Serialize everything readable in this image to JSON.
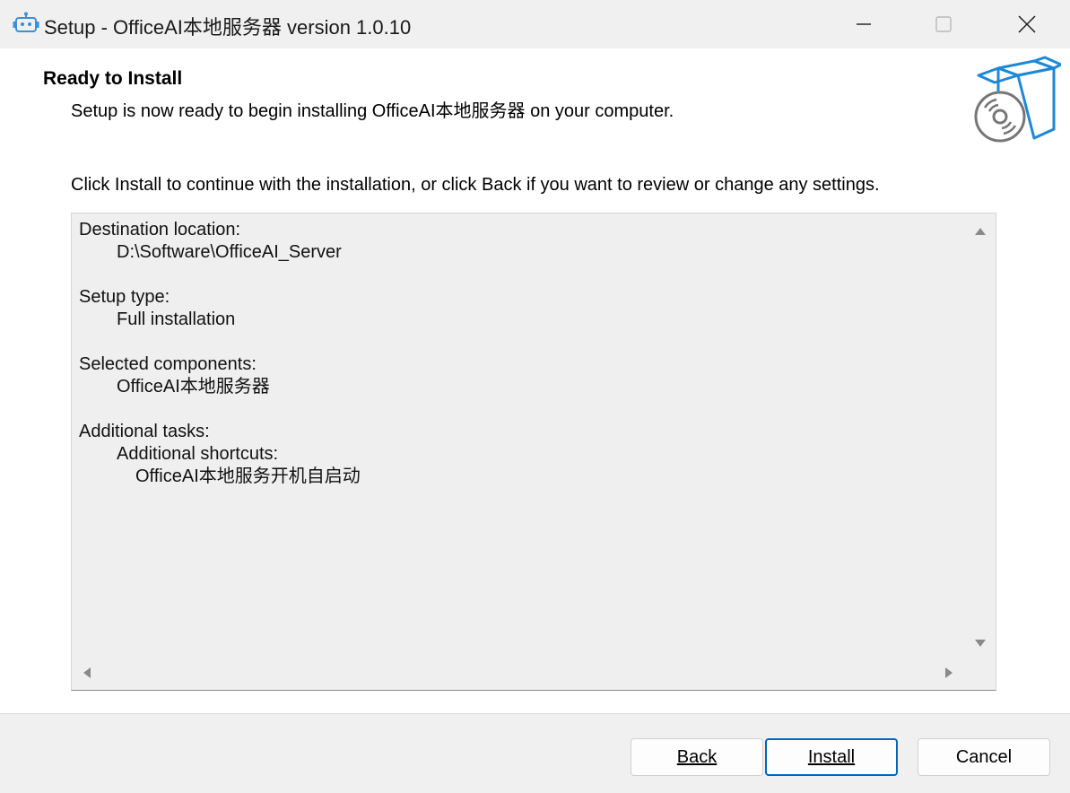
{
  "window": {
    "title": "Setup - OfficeAI本地服务器 version 1.0.10",
    "icon": "robot-setup-icon"
  },
  "page": {
    "title": "Ready to Install",
    "subtitle": "Setup is now ready to begin installing OfficeAI本地服务器 on your computer.",
    "wizard_icon": "software-box-disc-icon"
  },
  "instructions": "Click Install to continue with the installation, or click Back if you want to review or change any settings.",
  "memo": {
    "lines": [
      {
        "text": "Destination location:",
        "indent": 0
      },
      {
        "text": "D:\\Software\\OfficeAI_Server",
        "indent": 1
      },
      {
        "text": "",
        "indent": 0
      },
      {
        "text": "Setup type:",
        "indent": 0
      },
      {
        "text": "Full installation",
        "indent": 1
      },
      {
        "text": "",
        "indent": 0
      },
      {
        "text": "Selected components:",
        "indent": 0
      },
      {
        "text": "OfficeAI本地服务器",
        "indent": 1
      },
      {
        "text": "",
        "indent": 0
      },
      {
        "text": "Additional tasks:",
        "indent": 0
      },
      {
        "text": "Additional shortcuts:",
        "indent": 1
      },
      {
        "text": "OfficeAI本地服务开机自启动",
        "indent": 2
      }
    ]
  },
  "buttons": {
    "back": "Back",
    "install": "Install",
    "cancel": "Cancel"
  },
  "colors": {
    "accent": "#0067c0",
    "footer_bg": "#f0f0f0",
    "memo_bg": "#efefef",
    "icon_blue": "#1e88d6"
  }
}
